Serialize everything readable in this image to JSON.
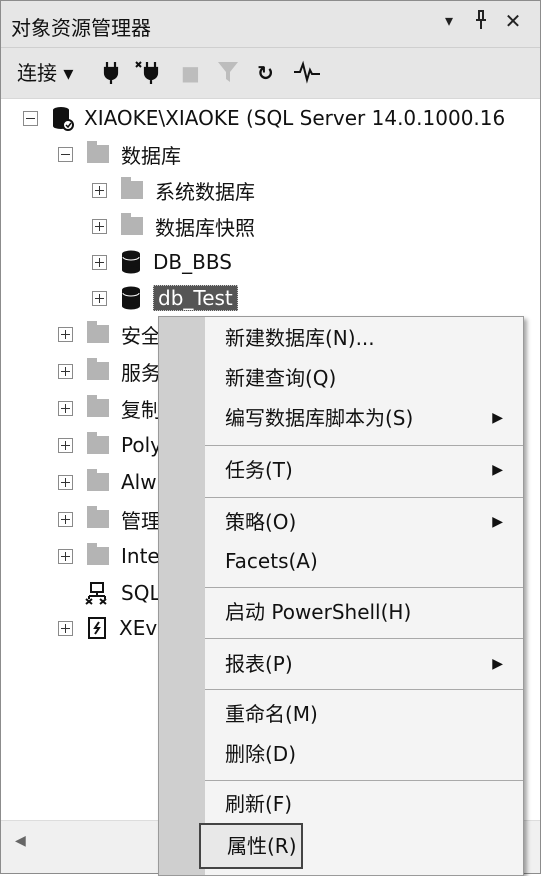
{
  "titlebar": {
    "title": "对象资源管理器",
    "dropdown_icon": "▾",
    "pin_icon": "⊥",
    "close_icon": "✕"
  },
  "toolbar": {
    "connect_label": "连接 ▾",
    "connect_icon": "plug-icon",
    "disconnect_icon": "plug-x-icon",
    "stop_icon": "■",
    "filter_icon": "▼",
    "refresh_icon": "↻",
    "activity_icon": "⁓"
  },
  "tree": {
    "server": "XIAOKE\\XIAOKE (SQL Server 14.0.1000.16",
    "databases": "数据库",
    "system_databases": "系统数据库",
    "database_snapshots": "数据库快照",
    "db_bbs": "DB_BBS",
    "db_test": "db_Test",
    "security": "安全",
    "server_objects": "服务",
    "replication": "复制",
    "polybase": "Poly",
    "always_on": "Alw",
    "management": "管理",
    "integration": "Inte",
    "sql_agent": "SQL",
    "xevent": "XEv"
  },
  "context_menu": {
    "new_database": "新建数据库(N)...",
    "new_query": "新建查询(Q)",
    "script_as": "编写数据库脚本为(S)",
    "tasks": "任务(T)",
    "policies": "策略(O)",
    "facets": "Facets(A)",
    "start_powershell": "启动 PowerShell(H)",
    "reports": "报表(P)",
    "rename": "重命名(M)",
    "delete": "删除(D)",
    "refresh": "刷新(F)",
    "properties": "属性(R)",
    "submenu_arrow": "▶"
  },
  "scroll": {
    "left_arrow": "◀"
  }
}
